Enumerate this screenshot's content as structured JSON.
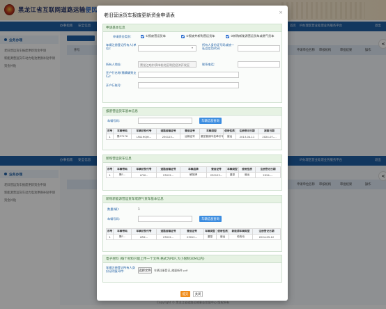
{
  "site": {
    "title_main": "黑龙江省互联网道路运输",
    "title_highlight": "便民",
    "nav_items": [
      "办事指南",
      "安全信息",
      "业务办理"
    ],
    "nav_right": [
      "首页",
      "IP办理区营业处理业务服务平台",
      "退出"
    ],
    "copyright": "Copyright © 黑龙江省道路运输事业发展中心 版权所有"
  },
  "sidebar": {
    "head": "业务办理",
    "items": [
      "老旧营运货车报废更新资金申请",
      "新能源营运货车动力电池更换补贴申请",
      "资金补贴"
    ]
  },
  "bg_table": {
    "top_headers": [
      "序号",
      "车牌号码",
      "申请时间",
      "车辆类型",
      "审核状态",
      "申请单位名称",
      "审核机构",
      "审批结果",
      "操作"
    ],
    "mid_headers": [
      "序号",
      "车牌号码",
      "申请时间",
      "车辆类型",
      "审核状态",
      "申请单位名称",
      "审核机构",
      "审批结果",
      "操作"
    ]
  },
  "modal": {
    "title": "老旧营运货车报废更新资金申请表",
    "close": "×",
    "panel_basic": {
      "head": "申请基本信息",
      "type_label": "申请资金类别:",
      "type_options": [
        "①报废营运货车",
        "②报废并新购营运货车",
        "③新购新能源营运货车或燃气货车"
      ],
      "unit_label": "车辆注册登记所有人(单位):",
      "unit_value": "",
      "credit_label": "所有人身份证号码或统一社会信用代码:",
      "credit_value": "",
      "addr_label": "所有人地址:",
      "addr_value": "黑龙江哈尔滨市松北区利民经济开发区",
      "phone_label": "联系电话:",
      "phone_value": "",
      "bank_label": "开户行名称(需精确到支行):",
      "bank_value": "",
      "account_label": "开户行账号:",
      "account_value": ""
    },
    "panel_scrap": {
      "head": "报废营运货车基本信息",
      "plate_label": "车辆号码:",
      "query_btn": "车辆信息查询",
      "headers": [
        "序号",
        "车辆号码",
        "车辆识别代号",
        "道路运输证号",
        "营运证号",
        "车辆类型",
        "使用性质",
        "注册登记日期",
        "报废日期"
      ],
      "rows": [
        [
          "1",
          "黑E7176",
          "LFA1H0JH...",
          "230123...",
          "运输证号",
          "重型普通半挂牵引车",
          "营运",
          "2013-04-11",
          "2024-07-..."
        ]
      ]
    },
    "panel_new": {
      "head": "新购营运货车信息",
      "headers": [
        "序号",
        "车辆号码",
        "车辆识别代号",
        "道路运输证号",
        "车辆品牌",
        "营运证号",
        "车辆类型",
        "使用性质",
        "注册登记日期"
      ],
      "rows": [
        [
          "1",
          "黑E...",
          "LFW...",
          "23012...",
          "解放牌",
          "230123...",
          "重型",
          "营运",
          "2024-..."
        ]
      ]
    },
    "panel_ev": {
      "head": "新购新能源营运货车或燃气货车基本信息",
      "count_label": "数量(辆):",
      "count_value": "1",
      "plate_label": "车辆号码:",
      "query_btn": "车辆信息查询",
      "headers": [
        "序号",
        "车辆号码",
        "车辆识别代号",
        "道路运输证号",
        "营运证号",
        "车辆类型",
        "使用性质",
        "新能源车辆类型",
        "注册登记日期"
      ],
      "rows": [
        [
          "1",
          "黑E...",
          "LRD...",
          "23012...",
          "23012...",
          "重型",
          "营运",
          "纯电动",
          "2024-05-12"
        ]
      ]
    },
    "panel_file": {
      "head": "电子材料 (每个材料只能上传一个文件,格式为PDF,大小限制30M以内)",
      "label": "车辆注册登记所有人身份证明复印件:",
      "btn": "选择文件",
      "note": "车辆注册登记_缩量新件.pdf"
    },
    "footer": {
      "submit": "提交",
      "close": "关闭"
    }
  }
}
